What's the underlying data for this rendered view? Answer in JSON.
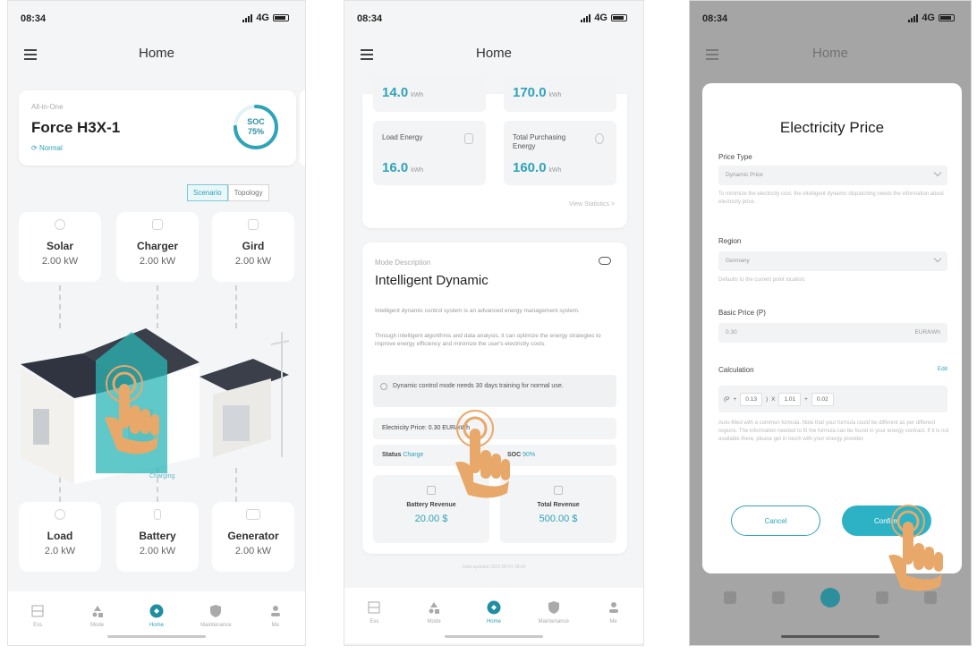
{
  "status": {
    "time": "08:34",
    "network": "4G"
  },
  "colors": {
    "accent": "#2fa3b8",
    "hand": "#e8a86a",
    "highlight": "#2bb5b5"
  },
  "icons": [
    "menu-icon",
    "battery-icon",
    "signal-icon",
    "solar-icon",
    "charger-icon",
    "grid-icon",
    "load-icon",
    "battery-storage-icon",
    "generator-icon",
    "device-icon",
    "mode-icon",
    "maintenance-icon",
    "profile-icon",
    "tap-hand-icon"
  ],
  "panel1": {
    "title": "Home",
    "device": {
      "subtitle": "All-in-One",
      "name": "Force H3X-1",
      "state": "Normal",
      "soc_label": "SOC",
      "soc_value": "75%",
      "soc_fraction": 0.75
    },
    "view_toggle": [
      "Scenario",
      "Topology"
    ],
    "tiles": [
      {
        "name": "Solar",
        "value": "2.00 kW"
      },
      {
        "name": "Charger",
        "value": "2.00 kW"
      },
      {
        "name": "Gird",
        "value": "2.00 kW"
      },
      {
        "name": "Load",
        "value": "2.0 kW"
      },
      {
        "name": "Battery",
        "value": "2.00 kW"
      },
      {
        "name": "Generator",
        "value": "2.00 kW"
      }
    ],
    "flow_label": "Charging"
  },
  "tabbar": [
    "Ess",
    "Mode",
    "Home",
    "Maintenance",
    "Me"
  ],
  "panel2": {
    "title": "Home",
    "stats": [
      {
        "label": "",
        "value": "14.0",
        "unit": "kWh"
      },
      {
        "label": "",
        "value": "170.0",
        "unit": "kWh"
      },
      {
        "label": "Load Energy",
        "value": "16.0",
        "unit": "kWh"
      },
      {
        "label": "Total Purchasing Energy",
        "value": "160.0",
        "unit": "kWh"
      }
    ],
    "view_stats": "View Statistics >",
    "mode": {
      "label": "Mode Description",
      "title": "Intelligent Dynamic",
      "desc1": "Intelligent dynamic control system is an advanced energy management system.",
      "desc2": "Through intelligent algorithms and data analysis, it can optimize the energy strategies to improve energy efficiency and minimize the user's electricity costs.",
      "notice": "Dynamic control mode needs 30 days training for normal use.",
      "price_row": "Electricity Price: 0.30 EUR/kWh",
      "status_label": "Status",
      "status_value": "Charge",
      "soc_label": "SOC",
      "soc_value": "90%",
      "revenue": [
        {
          "label": "Battery Revenue",
          "value": "20.00 $"
        },
        {
          "label": "Total Revenue",
          "value": "500.00 $"
        }
      ]
    },
    "legal": "Data updated 2023-09-01 08:34"
  },
  "panel3": {
    "bg_title": "Home",
    "modal": {
      "title": "Electricity Price",
      "price_type_label": "Price Type",
      "price_type_value": "Dynamic Price",
      "price_type_hint": "To minimize the electricity cost, the intelligent dynamic dispatching needs the information about electricity price.",
      "region_label": "Region",
      "region_value": "Germany",
      "region_hint": "Defaults to the current point location.",
      "basic_price_label": "Basic Price (P)",
      "basic_price_value": "0.30",
      "basic_price_unit": "EUR/kWh",
      "calc_label": "Calculation",
      "calc_edit": "Edit",
      "calc_parts": [
        "(P",
        "+",
        "0.13",
        ")",
        "X",
        "1.01",
        "+",
        "0.02"
      ],
      "calc_hint": "Auto-filled with a common formula. Note that your formula could be different as per different regions. The information needed to fit the formula can be found in your energy contract. If it is not available there, please get in touch with your energy provider.",
      "cancel": "Cancel",
      "confirm": "Confirm"
    }
  }
}
